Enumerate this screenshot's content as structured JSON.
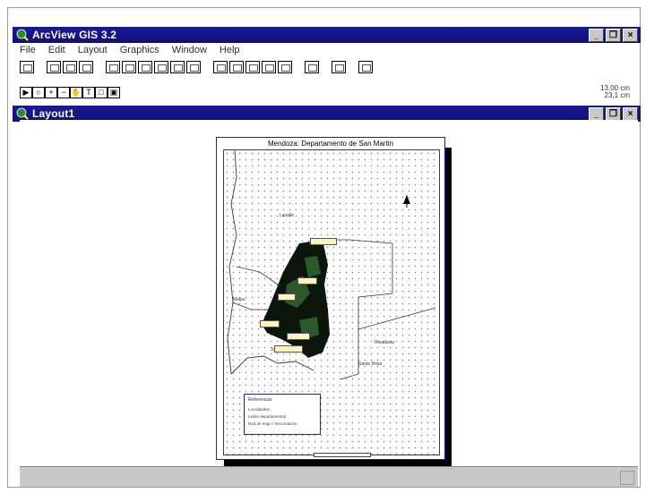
{
  "app": {
    "title": "ArcView GIS 3.2",
    "window_controls": [
      "_",
      "❐",
      "×"
    ]
  },
  "menu": [
    "File",
    "Edit",
    "Layout",
    "Graphics",
    "Window",
    "Help"
  ],
  "layout_window": {
    "title": "Layout1"
  },
  "scale_readout": {
    "line1": "13,00 cm",
    "line2": "23,1 cm"
  },
  "map": {
    "title": "Mendoza: Departamento de San Martin",
    "regions": [
      "Lavalle",
      "Maipu",
      "Rivadavia",
      "Santa Rosa",
      "Junin"
    ],
    "legend_title": "Referencias",
    "legend_items": [
      "Localidades",
      "Limite departamental",
      "Red de riego / Secundarios"
    ]
  },
  "colors": {
    "titlebar": "#10107a",
    "page_border": "#2020a0",
    "legend_border": "#2020c0"
  },
  "icons": [
    "arcview-globe-icon",
    "north-arrow-icon"
  ]
}
